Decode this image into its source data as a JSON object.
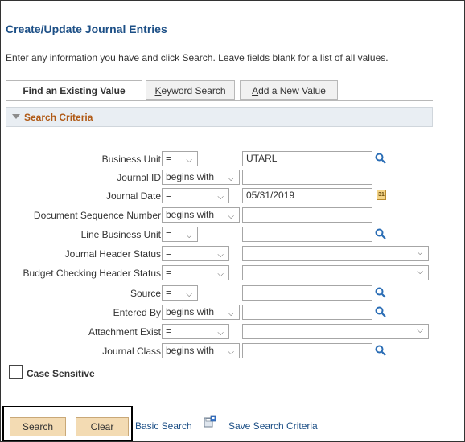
{
  "header": {
    "title": "Create/Update Journal Entries",
    "instructions": "Enter any information you have and click Search. Leave fields blank for a list of all values."
  },
  "tabs": [
    {
      "label": "Find an Existing Value",
      "active": true
    },
    {
      "label": "Keyword Search",
      "accesskey_letter": "K",
      "rest": "eyword Search"
    },
    {
      "label": "Add a New Value",
      "accesskey_letter": "A",
      "rest": "dd a New Value"
    }
  ],
  "section": {
    "title": "Search Criteria"
  },
  "fields": {
    "business_unit": {
      "label": "Business Unit",
      "operator": "=",
      "value": "UTARL"
    },
    "journal_id": {
      "label": "Journal ID",
      "operator": "begins with",
      "value": ""
    },
    "journal_date": {
      "label": "Journal Date",
      "operator": "=",
      "value": "05/31/2019",
      "calendar_glyph": "31"
    },
    "doc_seq": {
      "label": "Document Sequence Number",
      "operator": "begins with",
      "value": ""
    },
    "line_bu": {
      "label": "Line Business Unit",
      "operator": "=",
      "value": ""
    },
    "jh_status": {
      "label": "Journal Header Status",
      "operator": "=",
      "value": ""
    },
    "bch_status": {
      "label": "Budget Checking Header Status",
      "operator": "=",
      "value": ""
    },
    "source": {
      "label": "Source",
      "operator": "=",
      "value": ""
    },
    "entered_by": {
      "label": "Entered By",
      "operator": "begins with",
      "value": ""
    },
    "attachment": {
      "label": "Attachment Exist",
      "operator": "=",
      "value": ""
    },
    "journal_class": {
      "label": "Journal Class",
      "operator": "begins with",
      "value": ""
    }
  },
  "case_sensitive": {
    "label": "Case Sensitive",
    "checked": false
  },
  "buttons": {
    "search": "Search",
    "clear": "Clear"
  },
  "links": {
    "basic_search": "Basic Search",
    "save_search": "Save Search Criteria"
  },
  "icons": {
    "lookup": "magnifier-icon",
    "calendar": "calendar-icon",
    "save": "save-search-icon",
    "chevron": "chevron-down-icon"
  },
  "colors": {
    "title": "#1c4f86",
    "section_title": "#b05a16",
    "button_bg": "#f3dbb3"
  }
}
